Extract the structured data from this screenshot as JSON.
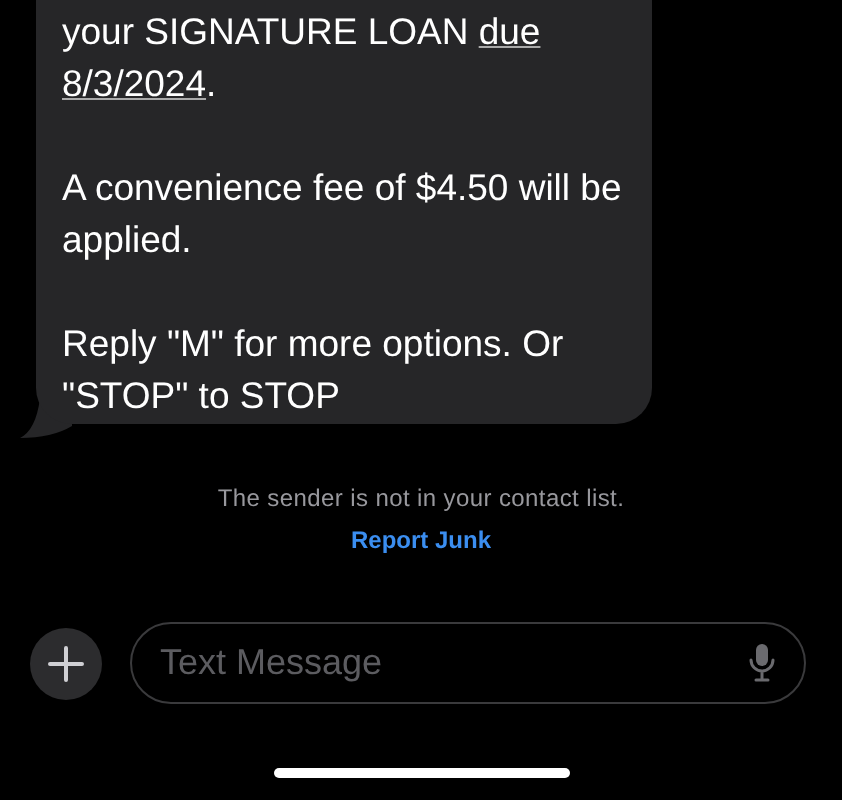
{
  "message": {
    "paragraphs": [
      [
        {
          "kind": "text",
          "text": "your SIGNATURE LOAN "
        },
        {
          "kind": "link",
          "text": "due"
        },
        {
          "kind": "link",
          "text": "8/3/2024"
        },
        {
          "kind": "text",
          "text": "."
        }
      ],
      [
        {
          "kind": "text",
          "text": "A convenience fee of $4.50 will be applied."
        }
      ],
      [
        {
          "kind": "text",
          "text": "Reply \"M\" for more options. Or \"STOP\" to STOP"
        }
      ]
    ]
  },
  "notice": {
    "text": "The sender is not in your contact list.",
    "action": "Report Junk"
  },
  "composer": {
    "placeholder": "Text Message"
  }
}
